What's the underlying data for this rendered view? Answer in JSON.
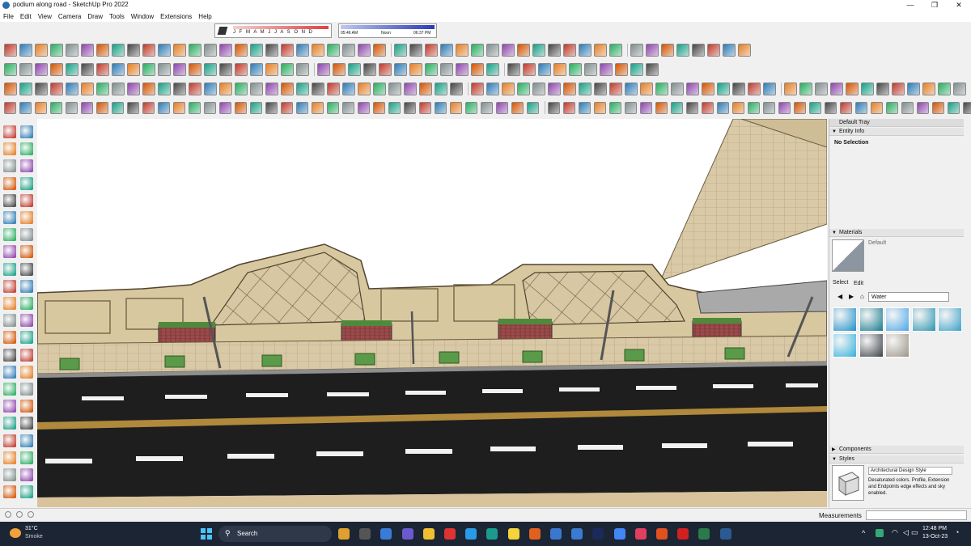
{
  "window": {
    "title": "podium along road - SketchUp Pro 2022",
    "min_icon": "minimize-icon",
    "max_icon": "maximize-icon",
    "close_icon": "close-icon"
  },
  "menu": [
    "File",
    "Edit",
    "View",
    "Camera",
    "Draw",
    "Tools",
    "Window",
    "Extensions",
    "Help"
  ],
  "shadow": {
    "months": "J F M A M J J A S O N D",
    "time_start": "05:46 AM",
    "time_mid": "Noon",
    "time_end": "06:37 PM"
  },
  "tray": {
    "title": "Default Tray",
    "entity_info": {
      "header": "Entity Info",
      "selection": "No Selection"
    },
    "materials": {
      "header": "Materials",
      "current": "Default",
      "tabs": [
        "Select",
        "Edit"
      ],
      "collection": "Water",
      "swatch_colors": [
        "#1e90c8",
        "#137a8c",
        "#4aa6e8",
        "#2b93b0",
        "#3a9fc8",
        "#33b1dc",
        "#3a4046",
        "#9c9486"
      ]
    },
    "components": {
      "header": "Components"
    },
    "styles": {
      "header": "Styles",
      "name": "Architectural Design Style",
      "description": "Desaturated colors. Profile, Extension and Endpoints edge effects and sky enabled."
    }
  },
  "status": {
    "measurements_label": "Measurements"
  },
  "taskbar": {
    "weather_temp": "31°C",
    "weather_desc": "Smoke",
    "search_placeholder": "Search",
    "time": "12:48 PM",
    "date": "13-Oct-23"
  }
}
